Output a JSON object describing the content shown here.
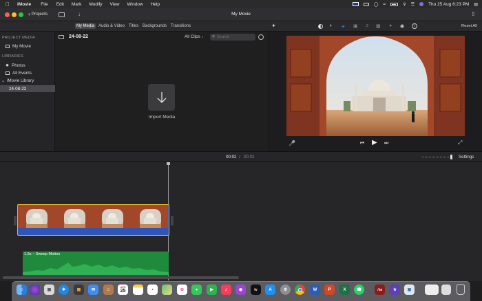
{
  "menubar": {
    "app": "iMovie",
    "items": [
      "File",
      "Edit",
      "Mark",
      "Modify",
      "View",
      "Window",
      "Help"
    ],
    "datetime": "Thu 25 Aug  6:23 PM"
  },
  "titlebar": {
    "projects_label": "Projects",
    "window_title": "My Movie"
  },
  "tabs": [
    "My Media",
    "Audio & Video",
    "Titles",
    "Backgrounds",
    "Transitions"
  ],
  "viewer_toolbar": {
    "reset_all": "Reset All"
  },
  "sidebar": {
    "project_media_header": "PROJECT MEDIA",
    "project_item": "My Movie",
    "libraries_header": "LIBRARIES",
    "photos": "Photos",
    "all_events": "All Events",
    "library_name": "iMovie Library",
    "event": "24-08-22"
  },
  "browser": {
    "event_title": "24-08-22",
    "clips_filter": "All Clips",
    "search_placeholder": "Search",
    "import_label": "Import Media"
  },
  "midbar": {
    "current_time": "00:02",
    "separator": "/",
    "total_time": "00:02",
    "settings_label": "Settings"
  },
  "timeline": {
    "audio_clip_label": "1.9s – Sweep Motion",
    "playhead_fraction": 1.0
  },
  "dock": {
    "calendar_month": "AUG",
    "calendar_day": "25",
    "appletv_label": "tv",
    "dictionary_label": "Aa"
  },
  "colors": {
    "accent_yellow": "#e6b32a",
    "audio_green": "#1f8a3c",
    "clip_blue": "#2f55b8",
    "tab_active": "#4a4a4d"
  }
}
